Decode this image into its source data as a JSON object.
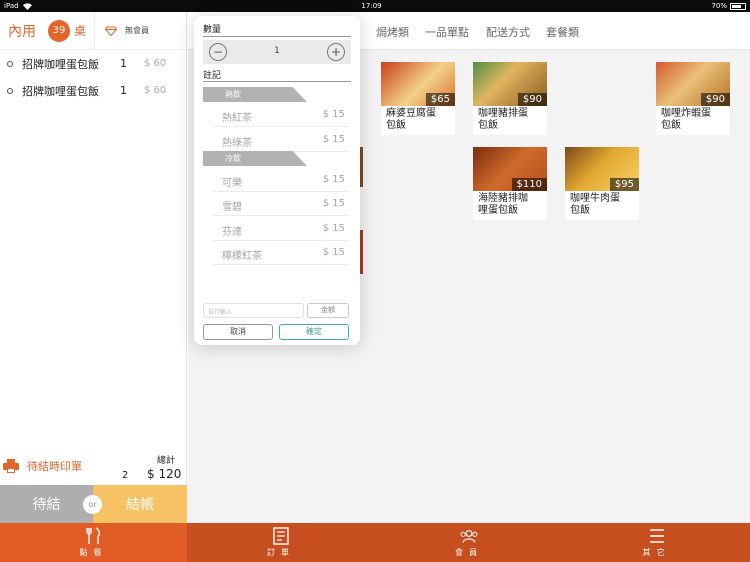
{
  "status_bar": {
    "device": "iPad",
    "wifi_icon": "wifi-icon",
    "time": "17:09",
    "battery": "70%",
    "battery_level": 0.7
  },
  "order": {
    "dine_type": "內用",
    "table_number": "39",
    "table_label": "桌",
    "member_icon": "diamond-icon",
    "member_label": "無會員",
    "items": [
      {
        "name": "招牌咖哩蛋包飯",
        "qty": "1",
        "price": "$ 60"
      },
      {
        "name": "招牌咖哩蛋包飯",
        "qty": "1",
        "price": "$ 60"
      }
    ],
    "print_label": "待結時印單",
    "total_label": "總計",
    "total_count": "2",
    "total_amount": "$ 120",
    "hold_label": "待結",
    "or_label": "or",
    "pay_label": "結帳"
  },
  "categories": [
    "焗烤類",
    "一品單點",
    "配送方式",
    "套餐類"
  ],
  "menu_items": [
    {
      "name": "麻婆豆腐蛋\n包飯",
      "price": "$65",
      "colors": [
        "#c93f1c",
        "#f2d18a"
      ]
    },
    {
      "name": "咖哩豬排蛋\n包飯",
      "price": "$90",
      "colors": [
        "#8a5a1f",
        "#4f8f45"
      ]
    },
    {
      "name": "咖哩炸蝦蛋\n包飯",
      "price": "$90",
      "colors": [
        "#b57326",
        "#d65a2c"
      ]
    },
    {
      "name": "海陸豬排咖\n哩蛋包飯",
      "price": "$110",
      "colors": [
        "#b44e1e",
        "#7a2e10"
      ]
    },
    {
      "name": "咖哩牛肉蛋\n包飯",
      "price": "$95",
      "colors": [
        "#e3a72f",
        "#7a4a1c"
      ]
    }
  ],
  "popover": {
    "qty_label": "數量",
    "qty_value": "1",
    "minus": "−",
    "plus": "+",
    "note_label": "註記",
    "groups": [
      {
        "name": "熱飲",
        "options": [
          {
            "name": "熱紅茶",
            "price": "$ 15"
          },
          {
            "name": "熱綠茶",
            "price": "$ 15"
          }
        ]
      },
      {
        "name": "冷飲",
        "options": [
          {
            "name": "可樂",
            "price": "$ 15"
          },
          {
            "name": "雪碧",
            "price": "$ 15"
          },
          {
            "name": "芬達",
            "price": "$ 15"
          },
          {
            "name": "檸檬紅茶",
            "price": "$ 15"
          }
        ]
      }
    ],
    "custom_placeholder": "自行輸入",
    "amount_label": "金額",
    "cancel_label": "取消",
    "confirm_label": "確定"
  },
  "tabbar": [
    {
      "label": "點餐",
      "icon": "utensils-icon",
      "active": true
    },
    {
      "label": "訂單",
      "icon": "receipt-icon",
      "active": false
    },
    {
      "label": "會員",
      "icon": "members-icon",
      "active": false
    },
    {
      "label": "其它",
      "icon": "menu-icon",
      "active": false
    }
  ],
  "colors": {
    "accent": "#e5642a",
    "tabbar": "#c74f1f",
    "pay": "#f7c263",
    "hold": "#aeaeae",
    "confirm": "#3bb0b0"
  }
}
